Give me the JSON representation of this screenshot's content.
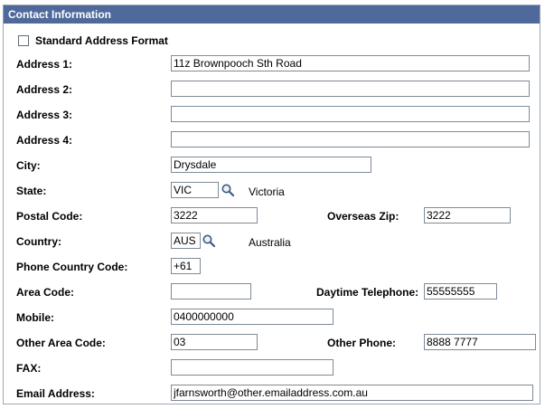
{
  "section": {
    "title": "Contact Information"
  },
  "standard_address": {
    "label": "Standard Address Format",
    "checked": false
  },
  "fields": {
    "address1": {
      "label": "Address 1:",
      "value": "11z Brownpooch Sth Road"
    },
    "address2": {
      "label": "Address 2:",
      "value": ""
    },
    "address3": {
      "label": "Address 3:",
      "value": ""
    },
    "address4": {
      "label": "Address 4:",
      "value": ""
    },
    "city": {
      "label": "City:",
      "value": "Drysdale"
    },
    "state": {
      "label": "State:",
      "value": "VIC",
      "description": "Victoria"
    },
    "postal_code": {
      "label": "Postal Code:",
      "value": "3222"
    },
    "overseas_zip": {
      "label": "Overseas Zip:",
      "value": "3222"
    },
    "country": {
      "label": "Country:",
      "value": "AUS",
      "description": "Australia"
    },
    "phone_country_code": {
      "label": "Phone Country Code:",
      "value": "+61"
    },
    "area_code": {
      "label": "Area Code:",
      "value": ""
    },
    "daytime_telephone": {
      "label": "Daytime Telephone:",
      "value": "55555555"
    },
    "mobile": {
      "label": "Mobile:",
      "value": "0400000000"
    },
    "other_area_code": {
      "label": "Other Area Code:",
      "value": "03"
    },
    "other_phone": {
      "label": "Other Phone:",
      "value": "8888 7777"
    },
    "fax": {
      "label": "FAX:",
      "value": ""
    },
    "email": {
      "label": "Email Address:",
      "value": "jfarnsworth@other.emailaddress.com.au"
    }
  },
  "icons": {
    "lookup": "magnifier-icon"
  },
  "colors": {
    "header_bg": "#4f6a9a",
    "header_text": "#ffffff",
    "border": "#9ea7b3"
  }
}
